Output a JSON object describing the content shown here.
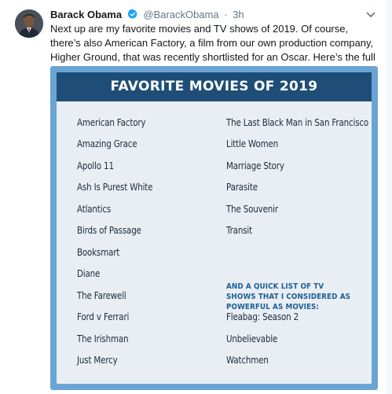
{
  "tweet": {
    "author_name": "Barack Obama",
    "handle": "@BarackObama",
    "separator": "·",
    "timestamp": "3h",
    "text": "Next up are my favorite movies and TV shows of 2019. Of course, there’s also American Factory, a film from our own production company, Higher Ground, that was recently shortlisted for an Oscar. Here’s the full list:",
    "verified_icon": "verified-badge-icon",
    "menu_icon": "chevron-down-icon"
  },
  "media": {
    "title": "FAVORITE MOVIES OF 2019",
    "movies_left": [
      "American Factory",
      "Amazing Grace",
      "Apollo 11",
      "Ash Is Purest White",
      "Atlantics",
      "Birds of Passage",
      "Booksmart",
      "Diane",
      "The Farewell",
      "Ford v Ferrari",
      "The Irishman",
      "Just Mercy"
    ],
    "movies_right": [
      "The Last Black Man in San Francisco",
      "Little Women",
      "Marriage Story",
      "Parasite",
      "The Souvenir",
      "Transit"
    ],
    "tv_heading": "AND A QUICK LIST OF TV SHOWS THAT I CONSIDERED AS POWERFUL AS MOVIES:",
    "tv_shows": [
      "Fleabag: Season 2",
      "Unbelievable",
      "Watchmen"
    ],
    "colors": {
      "frame": "#6aa4d4",
      "banner": "#1e4e77",
      "card": "#e9eef4",
      "tv_heading": "#1e5f94",
      "verified": "#1da1f2"
    }
  }
}
